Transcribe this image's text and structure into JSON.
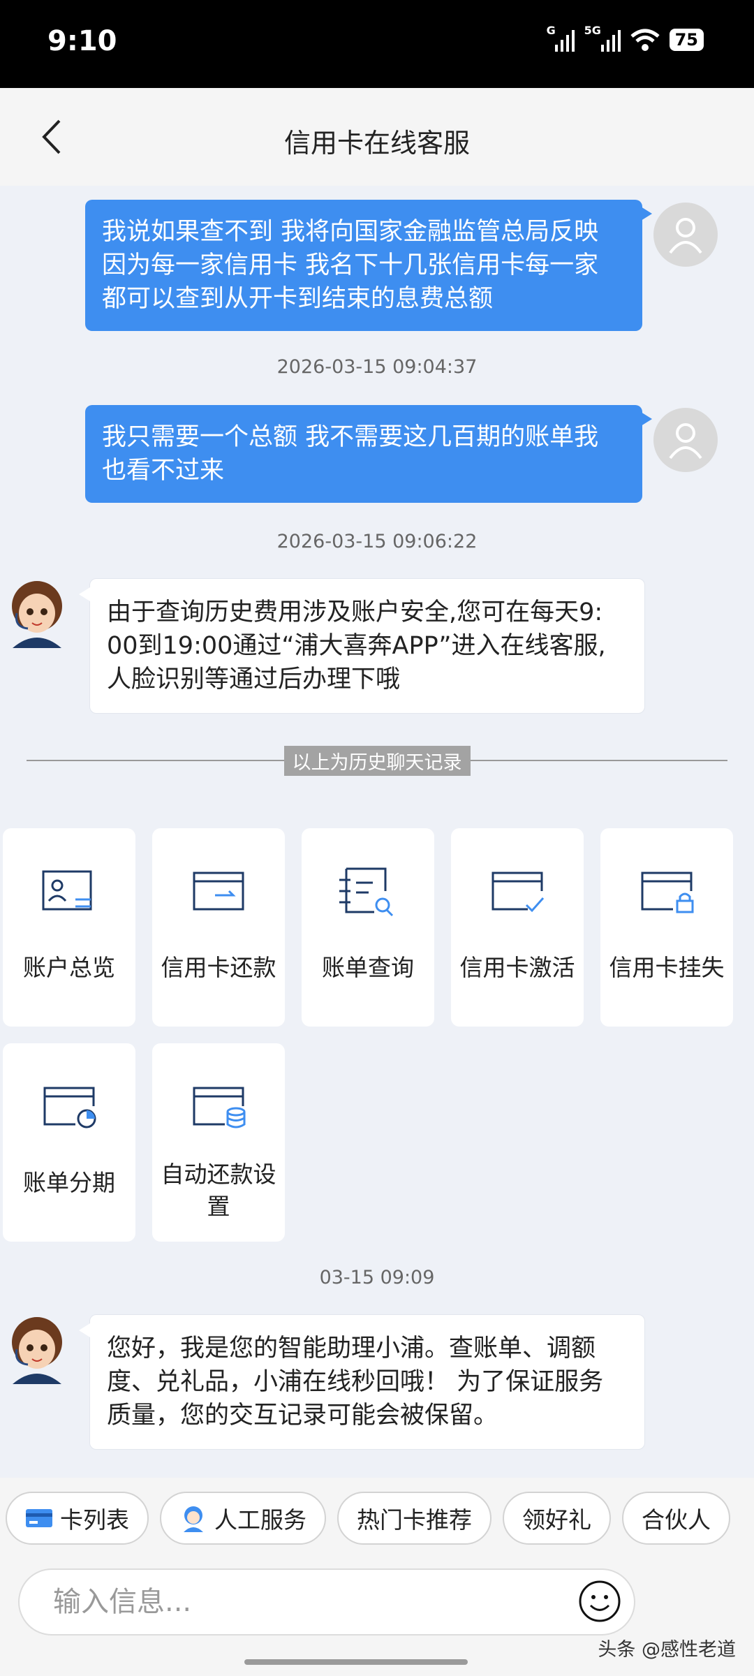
{
  "status_bar": {
    "time": "9:10",
    "signal1_label": "G",
    "signal2_label": "5G",
    "battery": "75",
    "icons": [
      "signal-icon",
      "signal-5g-icon",
      "wifi-icon",
      "battery-icon"
    ]
  },
  "header": {
    "title": "信用卡在线客服",
    "back_icon": "chevron-left-icon"
  },
  "messages": {
    "user1": {
      "lines": [
        "我说如果查不到 我将向国家金融监管总局反映",
        "因为每一家信用卡 我名下十几张信用卡每一家",
        "都可以查到从开卡到结束的息费总额"
      ]
    },
    "ts1": "2026-03-15 09:04:37",
    "user2": {
      "lines": [
        "我只需要一个总额 我不需要这几百期的账单我",
        "也看不过来"
      ]
    },
    "ts2": "2026-03-15 09:06:22",
    "bot1": {
      "lines": [
        "由于查询历史费用涉及账户安全,您可在每天9:",
        "00到19:00通过“浦大喜奔APP”进入在线客服,",
        "人脸识别等通过后办理下哦"
      ]
    },
    "history_divider": "以上为历史聊天记录",
    "ts3": "03-15 09:09",
    "bot2": {
      "lines": [
        "您好，我是您的智能助理小浦。查账单、调额",
        "度、兑礼品，小浦在线秒回哦！ 为了保证服务",
        "质量，您的交互记录可能会被保留。"
      ]
    }
  },
  "quick_menu": [
    {
      "label": "账户总览",
      "icon": "account-overview-icon"
    },
    {
      "label": "信用卡还款",
      "icon": "card-repayment-icon"
    },
    {
      "label": "账单查询",
      "icon": "bill-search-icon"
    },
    {
      "label": "信用卡激活",
      "icon": "card-activate-icon"
    },
    {
      "label": "信用卡挂失",
      "icon": "card-lock-icon"
    },
    {
      "label": "账单分期",
      "icon": "bill-installment-icon"
    },
    {
      "label": "自动还款设",
      "label2": "置",
      "icon": "auto-repay-icon"
    }
  ],
  "chips": [
    {
      "label": "卡列表",
      "icon": "card-list-icon"
    },
    {
      "label": "人工服务",
      "icon": "agent-icon"
    },
    {
      "label": "热门卡推荐"
    },
    {
      "label": "领好礼"
    },
    {
      "label": "合伙人"
    }
  ],
  "input": {
    "placeholder": "输入信息..."
  },
  "watermark": "头条 @感性老道",
  "colors": {
    "accent": "#3e8ef0",
    "icon_navy": "#1e3a66"
  }
}
